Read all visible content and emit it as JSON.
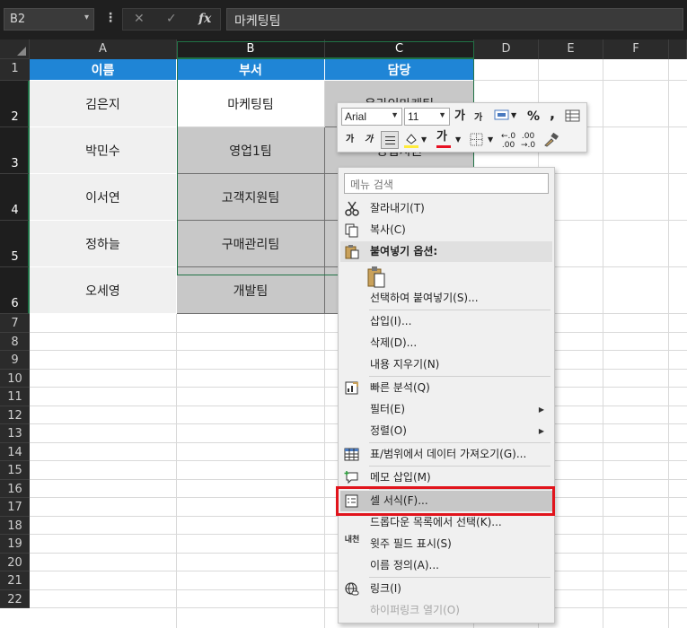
{
  "formula_bar": {
    "name_box": "B2",
    "name_dropdown_glyph": "▾",
    "dots": "⋮",
    "cancel_glyph": "✕",
    "enter_glyph": "✓",
    "fx_glyph": "fx",
    "formula": "마케팅팀"
  },
  "columns": [
    "A",
    "B",
    "C",
    "D",
    "E",
    "F"
  ],
  "rows": [
    "1",
    "2",
    "3",
    "4",
    "5",
    "6",
    "7",
    "8",
    "9",
    "10",
    "11",
    "12",
    "13",
    "14",
    "15",
    "16",
    "17",
    "18",
    "19",
    "20",
    "21",
    "22"
  ],
  "table": {
    "headers": [
      "이름",
      "부서",
      "담당"
    ],
    "rows": [
      [
        "김은지",
        "마케팅팀",
        "온라인마케팅"
      ],
      [
        "박민수",
        "영업1팀",
        "영업지원"
      ],
      [
        "이서연",
        "고객지원팀",
        ""
      ],
      [
        "정하늘",
        "구매관리팀",
        ""
      ],
      [
        "오세영",
        "개발팀",
        ""
      ]
    ]
  },
  "mini_toolbar": {
    "font_name": "Arial",
    "font_size": "11",
    "grow_font": "가",
    "shrink_font": "가",
    "percent": "%",
    "comma": ",",
    "bold": "가",
    "italic": "가",
    "font_color_glyph": "가",
    "font_color": "#e81123",
    "fill_color": "#ffeb3b"
  },
  "context_menu": {
    "search_placeholder": "메뉴 검색",
    "items": [
      {
        "label": "잘라내기(T)",
        "icon": "scissors-icon"
      },
      {
        "label": "복사(C)",
        "icon": "copy-icon"
      },
      {
        "label": "붙여넣기 옵션:",
        "icon": "paste-icon"
      },
      {
        "label": "선택하여 붙여넣기(S)...",
        "icon": ""
      },
      {
        "label": "삽입(I)...",
        "icon": ""
      },
      {
        "label": "삭제(D)...",
        "icon": ""
      },
      {
        "label": "내용 지우기(N)",
        "icon": ""
      },
      {
        "label": "빠른 분석(Q)",
        "icon": "quick-analysis-icon"
      },
      {
        "label": "필터(E)",
        "icon": ""
      },
      {
        "label": "정렬(O)",
        "icon": ""
      },
      {
        "label": "표/범위에서 데이터 가져오기(G)...",
        "icon": "table-icon"
      },
      {
        "label": "메모 삽입(M)",
        "icon": "comment-icon"
      },
      {
        "label": "셀 서식(F)...",
        "icon": "format-cells-icon"
      },
      {
        "label": "드롭다운 목록에서 선택(K)...",
        "icon": ""
      },
      {
        "label": "윗주 필드 표시(S)",
        "icon": "phonetic-icon"
      },
      {
        "label": "이름 정의(A)...",
        "icon": ""
      },
      {
        "label": "링크(I)",
        "icon": "link-icon"
      },
      {
        "label": "하이퍼링크 열기(O)",
        "icon": ""
      }
    ],
    "submenu_arrow": "▶",
    "phonetic_glyph": "내천"
  },
  "colors": {
    "header_blue": "#1f85d6",
    "selection_green": "#217346",
    "highlight_red": "#e1141c"
  }
}
